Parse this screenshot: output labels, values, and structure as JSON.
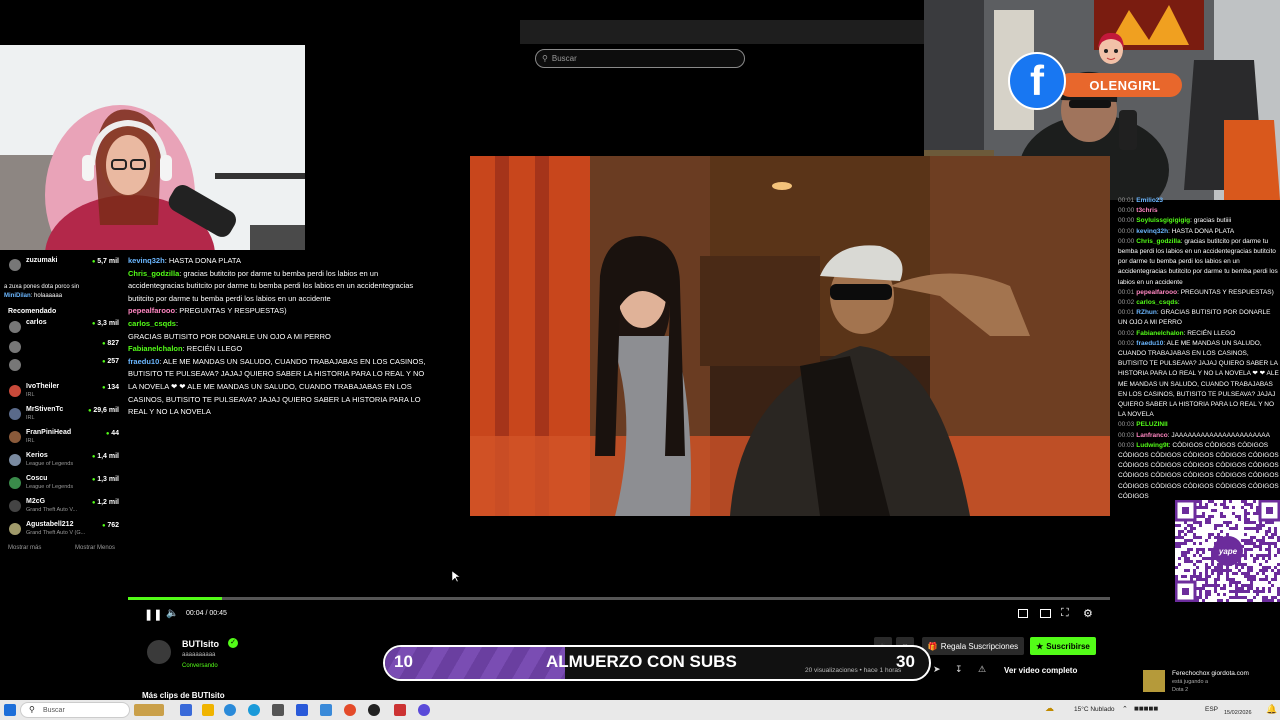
{
  "search": {
    "placeholder": "Buscar"
  },
  "overlay": {
    "facebook_name": "OLENGIRL",
    "banner": {
      "current": "10",
      "title": "ALMUERZO CON SUBS",
      "goal": "30",
      "progress_fraction": 0.33
    }
  },
  "sidebar": {
    "recommended_label": "Recomendado",
    "items": [
      {
        "name": "zuzumaki",
        "game": "",
        "viewers": "5,7 mil"
      },
      {
        "name": "carlos",
        "game": "",
        "viewers": "3,3 mil"
      },
      {
        "name": "",
        "game": "",
        "viewers": "827"
      },
      {
        "name": "",
        "game": "",
        "viewers": "257"
      },
      {
        "name": "IvoTheiler",
        "game": "IRL",
        "viewers": "134"
      },
      {
        "name": "MrStivenTc",
        "game": "IRL",
        "viewers": "29,6 mil"
      },
      {
        "name": "FranPiniHead",
        "game": "IRL",
        "viewers": "44"
      },
      {
        "name": "Kerios",
        "game": "League of Legends",
        "viewers": "1,4 mil"
      },
      {
        "name": "Coscu",
        "game": "League of Legends",
        "viewers": "1,3 mil"
      },
      {
        "name": "M2cG",
        "game": "Grand Theft Auto V...",
        "viewers": "1,2 mil"
      },
      {
        "name": "Agustabell212",
        "game": "Grand Theft Auto V (G...",
        "viewers": "762"
      }
    ],
    "show_more": "Mostrar más",
    "show_less": "Mostrar Menos"
  },
  "chat_left": [
    {
      "user": "",
      "text": "a zuxa pones dota porco sin"
    },
    {
      "user": "MiniDilan",
      "text": ": holaaaaaa"
    },
    {
      "user": "kevinq32h",
      "text": ": HASTA DONA PLATA"
    },
    {
      "user": "Chris_godzilla",
      "text": ": gracias butitcito por darme tu bemba perdi los labios en un accidentegracias butitcito por darme tu bemba perdi los labios en un accidentegracias butitcito por darme tu bemba perdi los labios en un accidente"
    },
    {
      "user": "pepealfarooo",
      "text": ": PREGUNTAS Y RESPUESTAS)"
    },
    {
      "user": "carlos_csqds",
      "text": ":"
    },
    {
      "user": "",
      "text": "GRACIAS BUTISITO POR DONARLE UN OJO A MI PERRO"
    },
    {
      "user": "Fabianelchalon",
      "text": ": RECIÉN LLEGO"
    },
    {
      "user": "fraedu10",
      "text": ": ALE ME MANDAS UN SALUDO, CUANDO TRABAJABAS EN LOS CASINOS, BUTISITO TE PULSEAVA? JAJAJ QUIERO SABER LA HISTORIA PARA LO REAL Y NO LA NOVELA ❤ ❤ ALE ME MANDAS UN SALUDO, CUANDO TRABAJABAS EN LOS CASINOS, BUTISITO TE PULSEAVA? JAJAJ QUIERO SABER LA HISTORIA PARA LO REAL Y NO LA NOVELA"
    }
  ],
  "chat_right": [
    {
      "time": "00:01",
      "user": "Emilio23",
      "text": ""
    },
    {
      "time": "00:00",
      "user": "t3chris",
      "text": ""
    },
    {
      "time": "00:00",
      "user": "Soyluissgigigigig",
      "text": ": gracias butiiii"
    },
    {
      "time": "00:00",
      "user": "kevinq32h",
      "text": ": HASTA DONA PLATA"
    },
    {
      "time": "00:00",
      "user": "Chris_godzilla",
      "text": ": gracias butitcito por darme tu bemba perdi los labios en un accidentegracias butitcito por darme tu bemba perdi los labios en un accidentegracias butitcito por darme tu bemba perdi los labios en un accidente"
    },
    {
      "time": "00:01",
      "user": "pepealfarooo",
      "text": ": PREGUNTAS Y RESPUESTAS)"
    },
    {
      "time": "00:02",
      "user": "carlos_csqds",
      "text": ":"
    },
    {
      "time": "00:01",
      "user": "RZhun",
      "text": ": GRACIAS BUTISITO POR DONARLE UN OJO A MI PERRO"
    },
    {
      "time": "00:02",
      "user": "Fabianelchalon",
      "text": ": RECIÉN LLEGO"
    },
    {
      "time": "00:02",
      "user": "fraedu10",
      "text": ": ALE ME MANDAS UN SALUDO, CUANDO TRABAJABAS EN LOS CASINOS, BUTISITO TE PULSEAVA? JAJAJ QUIERO SABER LA HISTORIA PARA LO REAL Y NO LA NOVELA ❤ ❤ ALE ME MANDAS UN SALUDO, CUANDO TRABAJABAS EN LOS CASINOS, BUTISITO TE PULSEAVA? JAJAJ QUIERO SABER LA HISTORIA PARA LO REAL Y NO LA NOVELA"
    },
    {
      "time": "00:03",
      "user": "PELUZINII",
      "text": ""
    },
    {
      "time": "00:03",
      "user": "Lanfranco",
      "text": ": JAAAAAAAAAAAAAAAAAAAAAA"
    },
    {
      "time": "00:03",
      "user": "Ludwing9t",
      "text": ": CÓDIGOS CÓDIGOS CÓDIGOS CÓDIGOS CÓDIGOS CÓDIGOS CÓDIGOS CÓDIGOS CÓDIGOS CÓDIGOS CÓDIGOS CÓDIGOS CÓDIGOS CÓDIGOS CÓDIGOS CÓDIGOS CÓDIGOS CÓDIGOS CÓDIGOS CÓDIGOS CÓDIGOS CÓDIGOS CÓDIGOS CÓDIGOS"
    }
  ],
  "player": {
    "time": "00:04 / 00:45",
    "progress_fraction": 0.096
  },
  "channel": {
    "name": "BUTIsito",
    "subtitle": "aaaaaaaaaa",
    "status": "Conversando",
    "more_clips": "Más clips de BUTIsito",
    "gift_subs": "Regala Suscripciones",
    "subscribe": "Suscribirse",
    "views": "20 visualizaciones • hace 1 horas",
    "full_video": "Ver video completo"
  },
  "right_bottom": {
    "user": "Ferechochox giordota.com",
    "line2": "está jugando a",
    "line3": "Dota 2"
  },
  "taskbar": {
    "search": "Buscar",
    "weather": "15°C Nublado",
    "lang": "ESP",
    "date": "15/02/2026"
  },
  "colors": {
    "kick_green": "#53fc18",
    "facebook_blue": "#1877f2",
    "banner_purple": "#6a3fa0"
  }
}
